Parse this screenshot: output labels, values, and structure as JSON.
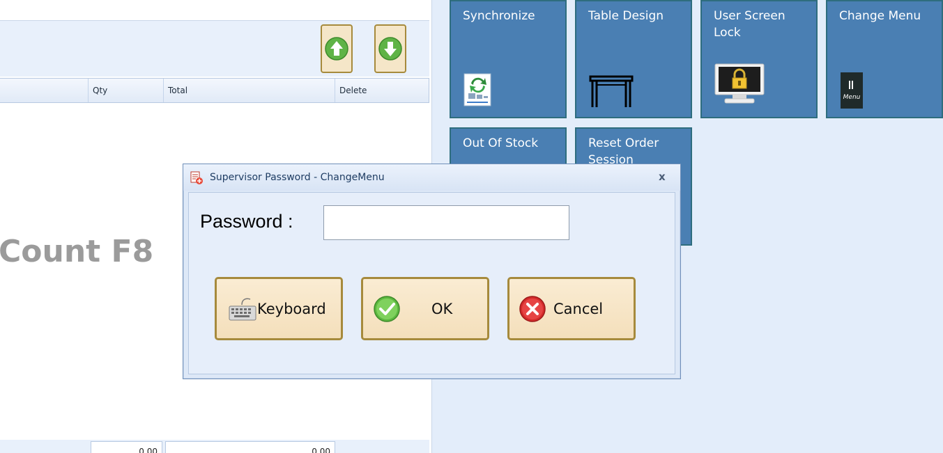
{
  "order_panel": {
    "columns": [
      "Qty",
      "Total",
      "Delete"
    ],
    "watermark_text": "Count F8",
    "totals": [
      "0.00",
      "0.00"
    ]
  },
  "navigation": {
    "up_icon": "arrow-up-icon",
    "down_icon": "arrow-down-icon"
  },
  "tiles": [
    {
      "label": "Synchronize",
      "icon": "sync-document-icon"
    },
    {
      "label": "Table Design",
      "icon": "table-icon"
    },
    {
      "label": "User Screen Lock",
      "icon": "monitor-lock-icon"
    },
    {
      "label": "Change Menu",
      "icon": "menu-book-icon"
    },
    {
      "label": "Out Of Stock",
      "icon": ""
    },
    {
      "label": "Reset Order Session",
      "icon": ""
    }
  ],
  "dialog": {
    "title": "Supervisor Password - ChangeMenu",
    "close_label": "x",
    "password_label": "Password :",
    "password_value": "",
    "buttons": {
      "keyboard": "Keyboard",
      "ok": "OK",
      "cancel": "Cancel"
    }
  },
  "colors": {
    "tile_bg": "#4a7fb3",
    "button_bg": "#f5e6c8",
    "button_border": "#a68a3c",
    "panel_bg": "#e3edfa"
  }
}
